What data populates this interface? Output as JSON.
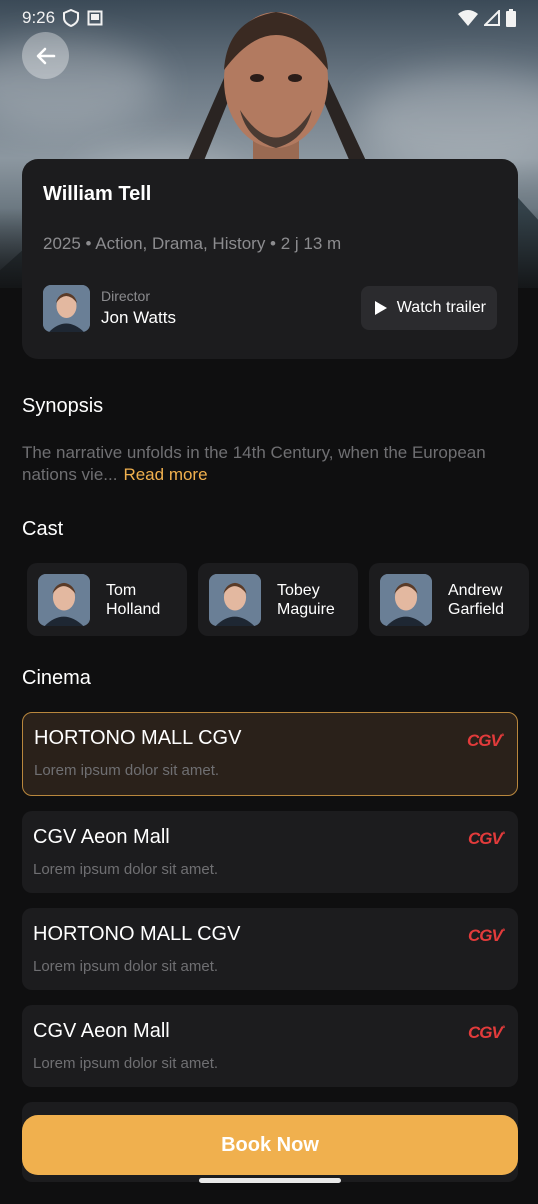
{
  "status_bar": {
    "time": "9:26"
  },
  "movie": {
    "title": "William Tell",
    "meta": "2025 • Action, Drama, History • 2 j 13 m",
    "director_label": "Director",
    "director_name": "Jon Watts",
    "trailer_label": "Watch trailer"
  },
  "synopsis": {
    "heading": "Synopsis",
    "text": "The narrative unfolds in the 14th Century, when the European nations vie...",
    "read_more": "Read more"
  },
  "cast": {
    "heading": "Cast",
    "members": [
      {
        "name": "Tom Holland"
      },
      {
        "name": "Tobey Maguire"
      },
      {
        "name": "Andrew Garfield"
      }
    ]
  },
  "cinema": {
    "heading": "Cinema",
    "logo_text": "CGV",
    "items": [
      {
        "name": "HORTONO MALL CGV",
        "desc": "Lorem ipsum dolor sit amet.",
        "selected": true
      },
      {
        "name": "CGV Aeon Mall",
        "desc": "Lorem ipsum dolor sit amet.",
        "selected": false
      },
      {
        "name": "HORTONO MALL CGV",
        "desc": "Lorem ipsum dolor sit amet.",
        "selected": false
      },
      {
        "name": "CGV Aeon Mall",
        "desc": "Lorem ipsum dolor sit amet.",
        "selected": false
      }
    ]
  },
  "book_button": "Book Now",
  "colors": {
    "accent": "#f0b04e",
    "card": "#1c1c1e",
    "background": "#0f0f10",
    "cgv_red": "#e23b3b"
  }
}
